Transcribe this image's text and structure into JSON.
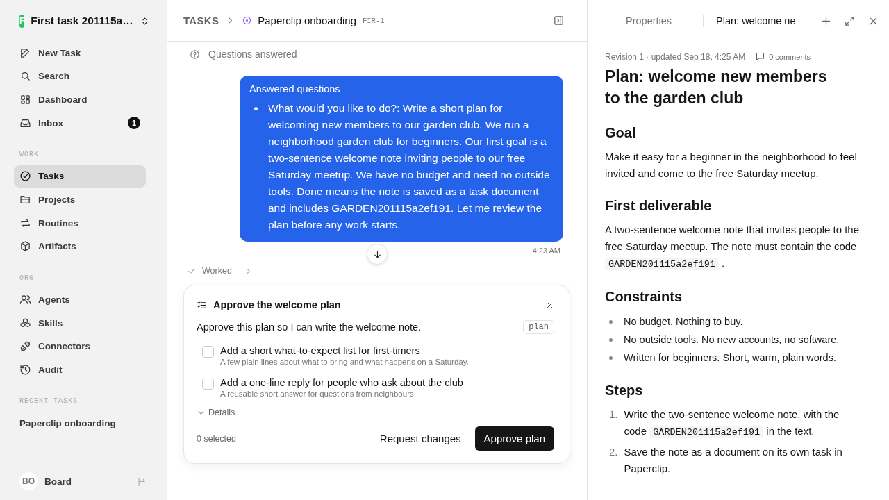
{
  "workspace": {
    "initial": "F",
    "name": "First task 201115a…"
  },
  "sidebar": [
    {
      "items": [
        {
          "label": "New Task",
          "selected": false
        },
        {
          "label": "Search",
          "selected": false
        },
        {
          "label": "Dashboard",
          "selected": false
        },
        {
          "label": "Inbox",
          "selected": false,
          "badge": "1"
        }
      ]
    },
    {
      "heading": "WORK",
      "items": [
        {
          "label": "Tasks",
          "selected": true
        },
        {
          "label": "Projects",
          "selected": false
        },
        {
          "label": "Routines",
          "selected": false
        },
        {
          "label": "Artifacts",
          "selected": false
        }
      ]
    },
    {
      "heading": "ORG",
      "items": [
        {
          "label": "Agents",
          "selected": false
        },
        {
          "label": "Skills",
          "selected": false
        },
        {
          "label": "Connectors",
          "selected": false
        },
        {
          "label": "Audit",
          "selected": false
        }
      ]
    },
    {
      "heading": "RECENT TASKS",
      "items": [
        {
          "label": "Paperclip onboarding",
          "selected": false
        }
      ]
    }
  ],
  "user": {
    "initials": "BO",
    "name": "Board"
  },
  "breadcrumb": {
    "root": "TASKS",
    "title": "Paperclip onboarding",
    "id": "FIR-1"
  },
  "event": "Questions answered",
  "message": {
    "title": "Answered questions",
    "items": [
      "What would you like to do?: Write a short plan for welcoming new members to our garden club. We run a neighborhood garden club for beginners. Our first goal is a two-sentence welcome note inviting people to our free Saturday meetup. We have no budget and need no outside tools. Done means the note is saved as a task document and includes GARDEN201115a2ef191. Let me review the plan before any work starts."
    ],
    "time": "4:23 AM"
  },
  "worked": "Worked",
  "approval": {
    "title": "Approve the welcome plan",
    "prompt": "Approve this plan so I can write the welcome note.",
    "tag": "plan",
    "options": [
      {
        "label": "Add a short what-to-expect list for first-timers",
        "hint": "A few plain lines about what to bring and what happens on a Saturday.",
        "checked": false
      },
      {
        "label": "Add a one-line reply for people who ask about the club",
        "hint": "A reusable short answer for questions from neighbours.",
        "checked": false
      }
    ],
    "details": "Details",
    "count": "0 selected",
    "secondary": "Request changes",
    "primary": "Approve plan"
  },
  "panel": {
    "tabs": [
      {
        "label": "Properties",
        "selected": false
      },
      {
        "label": "Plan: welcome ne",
        "selected": true
      }
    ],
    "meta": "Revision 1 · updated Sep 18, 4:25 AM",
    "comments": "0 comments",
    "title": "Plan: welcome new members to the garden club",
    "blocks": [
      {
        "kind": "heading",
        "text": "Goal"
      },
      {
        "kind": "paragraph",
        "parts": [
          {
            "kind": "text",
            "text": "Make it easy for a beginner in the neighborhood to feel invited and come to the free Saturday meetup."
          }
        ]
      },
      {
        "kind": "heading",
        "text": "First deliverable"
      },
      {
        "kind": "paragraph",
        "parts": [
          {
            "kind": "text",
            "text": "A two-sentence welcome note that invites people to the free Saturday meetup. The note must contain the code "
          },
          {
            "kind": "code",
            "text": "GARDEN201115a2ef191"
          },
          {
            "kind": "text",
            "text": " ."
          }
        ]
      },
      {
        "kind": "heading",
        "text": "Constraints"
      },
      {
        "kind": "bullets",
        "items": [
          [
            {
              "kind": "text",
              "text": "No budget. Nothing to buy."
            }
          ],
          [
            {
              "kind": "text",
              "text": "No outside tools. No new accounts, no software."
            }
          ],
          [
            {
              "kind": "text",
              "text": "Written for beginners. Short, warm, plain words."
            }
          ]
        ]
      },
      {
        "kind": "heading",
        "text": "Steps"
      },
      {
        "kind": "steps",
        "items": [
          {
            "number": "1.",
            "parts": [
              {
                "kind": "text",
                "text": "Write the two-sentence welcome note, with the code "
              },
              {
                "kind": "code",
                "text": "GARDEN201115a2ef191"
              },
              {
                "kind": "text",
                "text": " in the text."
              }
            ]
          },
          {
            "number": "2.",
            "parts": [
              {
                "kind": "text",
                "text": "Save the note as a document on its own task in Paperclip."
              }
            ]
          }
        ]
      }
    ]
  }
}
